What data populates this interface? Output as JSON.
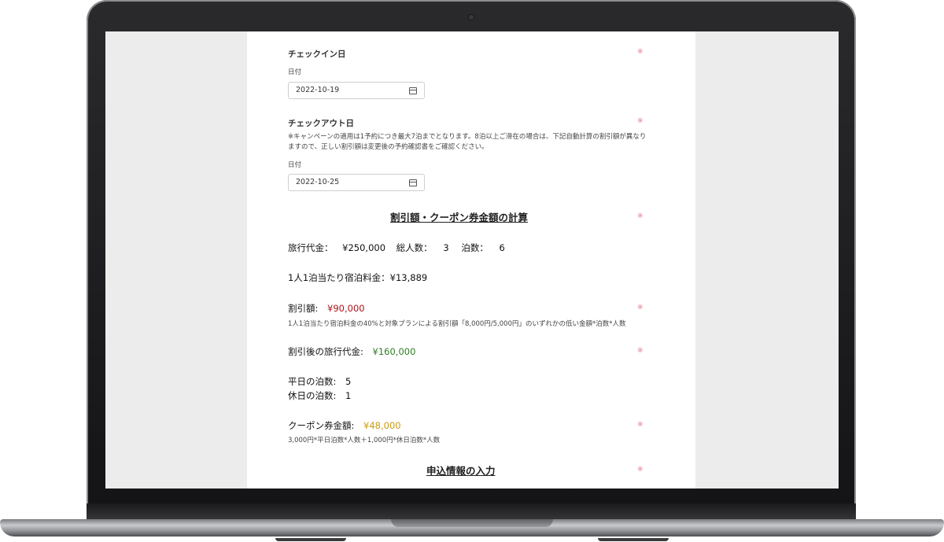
{
  "checkin": {
    "label": "チェックイン日",
    "required_mark": "※",
    "date_label": "日付",
    "date_value": "2022-10-19",
    "icon": "calendar-icon"
  },
  "checkout": {
    "label": "チェックアウト日",
    "required_mark": "※",
    "note_line1": "※キャンペーンの適用は1予約につき最大7泊までとなります。8泊以上ご滞在の場合は、下記自動計算の割引額が異なり",
    "note_line2": "ますので、正しい割引額は変更後の予約確認書をご確認ください。",
    "date_label": "日付",
    "date_value": "2022-10-25",
    "icon": "calendar-icon"
  },
  "calc": {
    "title": "割引額・クーポン券金額の計算",
    "required_mark": "※",
    "travel_cost_label": "旅行代金：",
    "travel_cost_value": "¥250,000",
    "people_label": "総人数：",
    "people_value": "3",
    "nights_label": "泊数：",
    "nights_value": "6",
    "per_person_label": "1人1泊当たり宿泊料金：",
    "per_person_value": "¥13,889",
    "discount_label": "割引額:",
    "discount_value": "¥90,000",
    "discount_mark": "※",
    "discount_note": "1人1泊当たり宿泊料金の40%と対象プランによる割引額「8,000円/5,000円」のいずれかの低い金額*泊数*人数",
    "after_label": "割引後の旅行代金:",
    "after_value": "¥160,000",
    "after_mark": "※",
    "weekday_label": "平日の泊数:",
    "weekday_value": "5",
    "holiday_label": "休日の泊数:",
    "holiday_value": "1",
    "coupon_label": "クーポン券金額:",
    "coupon_value": "¥48,000",
    "coupon_mark": "※",
    "coupon_note": "3,000円*平日泊数*人数＋1,000円*休日泊数*人数"
  },
  "apply": {
    "title": "申込情報の入力",
    "required_mark": "※"
  },
  "colors": {
    "discount": "#b0121c",
    "after_discount": "#2e7d21",
    "coupon": "#c89a10",
    "required_mark": "#e07a8a"
  }
}
